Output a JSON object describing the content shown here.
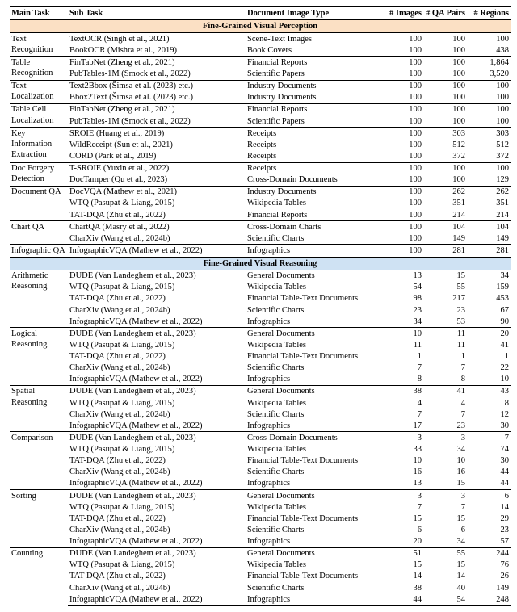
{
  "headers": {
    "main_task": "Main Task",
    "sub_task": "Sub Task",
    "doc_type": "Document Image Type",
    "n_images": "# Images",
    "n_qa": "# QA Pairs",
    "n_regions": "# Regions"
  },
  "sections": [
    {
      "title": "Fine-Grained Visual Perception",
      "class": "section-perception",
      "groups": [
        {
          "main": "Text Recognition",
          "rows": [
            {
              "sub": "TextOCR (Singh et al., 2021)",
              "doc": "Scene-Text Images",
              "i": "100",
              "q": "100",
              "r": "100"
            },
            {
              "sub": "BookOCR (Mishra et al., 2019)",
              "doc": "Book Covers",
              "i": "100",
              "q": "100",
              "r": "438"
            }
          ]
        },
        {
          "main": "Table Recognition",
          "rows": [
            {
              "sub": "FinTabNet (Zheng et al., 2021)",
              "doc": "Financial Reports",
              "i": "100",
              "q": "100",
              "r": "1,864"
            },
            {
              "sub": "PubTables-1M (Smock et al., 2022)",
              "doc": "Scientific Papers",
              "i": "100",
              "q": "100",
              "r": "3,520"
            }
          ]
        },
        {
          "main": "Text Localization",
          "rows": [
            {
              "sub": "Text2Bbox (Šimsa et al. (2023) etc.)",
              "doc": "Industry Documents",
              "i": "100",
              "q": "100",
              "r": "100"
            },
            {
              "sub": "Bbox2Text (Šimsa et al. (2023) etc.)",
              "doc": "Industry Documents",
              "i": "100",
              "q": "100",
              "r": "100"
            }
          ]
        },
        {
          "main": "Table Cell Localization",
          "rows": [
            {
              "sub": "FinTabNet (Zheng et al., 2021)",
              "doc": "Financial Reports",
              "i": "100",
              "q": "100",
              "r": "100"
            },
            {
              "sub": "PubTables-1M (Smock et al., 2022)",
              "doc": "Scientific Papers",
              "i": "100",
              "q": "100",
              "r": "100"
            }
          ]
        },
        {
          "main": "Key Information Extraction",
          "rows": [
            {
              "sub": "SROIE (Huang et al., 2019)",
              "doc": "Receipts",
              "i": "100",
              "q": "303",
              "r": "303"
            },
            {
              "sub": "WildReceipt (Sun et al., 2021)",
              "doc": "Receipts",
              "i": "100",
              "q": "512",
              "r": "512"
            },
            {
              "sub": "CORD (Park et al., 2019)",
              "doc": "Receipts",
              "i": "100",
              "q": "372",
              "r": "372"
            }
          ]
        },
        {
          "main": "Doc Forgery Detection",
          "rows": [
            {
              "sub": "T-SROIE (Yuxin et al., 2022)",
              "doc": "Receipts",
              "i": "100",
              "q": "100",
              "r": "100"
            },
            {
              "sub": "DocTamper (Qu et al., 2023)",
              "doc": "Cross-Domain Documents",
              "i": "100",
              "q": "100",
              "r": "129"
            }
          ]
        },
        {
          "main": "Document QA",
          "rows": [
            {
              "sub": "DocVQA (Mathew et al., 2021)",
              "doc": "Industry Documents",
              "i": "100",
              "q": "262",
              "r": "262"
            },
            {
              "sub": "WTQ (Pasupat & Liang, 2015)",
              "doc": "Wikipedia Tables",
              "i": "100",
              "q": "351",
              "r": "351"
            },
            {
              "sub": "TAT-DQA (Zhu et al., 2022)",
              "doc": "Financial Reports",
              "i": "100",
              "q": "214",
              "r": "214"
            }
          ]
        },
        {
          "main": "Chart QA",
          "rows": [
            {
              "sub": "ChartQA (Masry et al., 2022)",
              "doc": "Cross-Domain Charts",
              "i": "100",
              "q": "104",
              "r": "104"
            },
            {
              "sub": "CharXiv (Wang et al., 2024b)",
              "doc": "Scientific Charts",
              "i": "100",
              "q": "149",
              "r": "149"
            }
          ]
        },
        {
          "main": "Infographic QA",
          "rows": [
            {
              "sub": "InfographicVQA (Mathew et al., 2022)",
              "doc": "Infographics",
              "i": "100",
              "q": "281",
              "r": "281"
            }
          ]
        }
      ]
    },
    {
      "title": "Fine-Grained Visual Reasoning",
      "class": "section-reasoning",
      "groups": [
        {
          "main": "Arithmetic Reasoning",
          "rows": [
            {
              "sub": "DUDE (Van Landeghem et al., 2023)",
              "doc": "General Documents",
              "i": "13",
              "q": "15",
              "r": "34"
            },
            {
              "sub": "WTQ (Pasupat & Liang, 2015)",
              "doc": "Wikipedia Tables",
              "i": "54",
              "q": "55",
              "r": "159"
            },
            {
              "sub": "TAT-DQA (Zhu et al., 2022)",
              "doc": "Financial Table-Text Documents",
              "i": "98",
              "q": "217",
              "r": "453"
            },
            {
              "sub": "CharXiv (Wang et al., 2024b)",
              "doc": "Scientific Charts",
              "i": "23",
              "q": "23",
              "r": "67"
            },
            {
              "sub": "InfographicVQA (Mathew et al., 2022)",
              "doc": "Infographics",
              "i": "34",
              "q": "53",
              "r": "90"
            }
          ]
        },
        {
          "main": "Logical Reasoning",
          "rows": [
            {
              "sub": "DUDE (Van Landeghem et al., 2023)",
              "doc": "General Documents",
              "i": "10",
              "q": "11",
              "r": "20"
            },
            {
              "sub": "WTQ (Pasupat & Liang, 2015)",
              "doc": "Wikipedia Tables",
              "i": "11",
              "q": "11",
              "r": "41"
            },
            {
              "sub": "TAT-DQA (Zhu et al., 2022)",
              "doc": "Financial Table-Text Documents",
              "i": "1",
              "q": "1",
              "r": "1"
            },
            {
              "sub": "CharXiv (Wang et al., 2024b)",
              "doc": "Scientific Charts",
              "i": "7",
              "q": "7",
              "r": "22"
            },
            {
              "sub": "InfographicVQA (Mathew et al., 2022)",
              "doc": "Infographics",
              "i": "8",
              "q": "8",
              "r": "10"
            }
          ]
        },
        {
          "main": "Spatial Reasoning",
          "rows": [
            {
              "sub": "DUDE (Van Landeghem et al., 2023)",
              "doc": "General Documents",
              "i": "38",
              "q": "41",
              "r": "43"
            },
            {
              "sub": "WTQ (Pasupat & Liang, 2015)",
              "doc": "Wikipedia Tables",
              "i": "4",
              "q": "4",
              "r": "8"
            },
            {
              "sub": "CharXiv (Wang et al., 2024b)",
              "doc": "Scientific Charts",
              "i": "7",
              "q": "7",
              "r": "12"
            },
            {
              "sub": "InfographicVQA (Mathew et al., 2022)",
              "doc": "Infographics",
              "i": "17",
              "q": "23",
              "r": "30"
            }
          ]
        },
        {
          "main": "Comparison",
          "rows": [
            {
              "sub": "DUDE (Van Landeghem et al., 2023)",
              "doc": "Cross-Domain Documents",
              "i": "3",
              "q": "3",
              "r": "7"
            },
            {
              "sub": "WTQ (Pasupat & Liang, 2015)",
              "doc": "Wikipedia Tables",
              "i": "33",
              "q": "34",
              "r": "74"
            },
            {
              "sub": "TAT-DQA (Zhu et al., 2022)",
              "doc": "Financial Table-Text Documents",
              "i": "10",
              "q": "10",
              "r": "30"
            },
            {
              "sub": "CharXiv (Wang et al., 2024b)",
              "doc": "Scientific Charts",
              "i": "16",
              "q": "16",
              "r": "44"
            },
            {
              "sub": "InfographicVQA (Mathew et al., 2022)",
              "doc": "Infographics",
              "i": "13",
              "q": "15",
              "r": "44"
            }
          ]
        },
        {
          "main": "Sorting",
          "rows": [
            {
              "sub": "DUDE (Van Landeghem et al., 2023)",
              "doc": "General Documents",
              "i": "3",
              "q": "3",
              "r": "6"
            },
            {
              "sub": "WTQ (Pasupat & Liang, 2015)",
              "doc": "Wikipedia Tables",
              "i": "7",
              "q": "7",
              "r": "14"
            },
            {
              "sub": "TAT-DQA (Zhu et al., 2022)",
              "doc": "Financial Table-Text Documents",
              "i": "15",
              "q": "15",
              "r": "29"
            },
            {
              "sub": "CharXiv (Wang et al., 2024b)",
              "doc": "Scientific Charts",
              "i": "6",
              "q": "6",
              "r": "23"
            },
            {
              "sub": "InfographicVQA (Mathew et al., 2022)",
              "doc": "Infographics",
              "i": "20",
              "q": "34",
              "r": "57"
            }
          ]
        },
        {
          "main": "Counting",
          "rows": [
            {
              "sub": "DUDE (Van Landeghem et al., 2023)",
              "doc": "General Documents",
              "i": "51",
              "q": "55",
              "r": "244"
            },
            {
              "sub": "WTQ (Pasupat & Liang, 2015)",
              "doc": "Wikipedia Tables",
              "i": "15",
              "q": "15",
              "r": "76"
            },
            {
              "sub": "TAT-DQA (Zhu et al., 2022)",
              "doc": "Financial Table-Text Documents",
              "i": "14",
              "q": "14",
              "r": "26"
            },
            {
              "sub": "CharXiv (Wang et al., 2024b)",
              "doc": "Scientific Charts",
              "i": "38",
              "q": "40",
              "r": "149"
            },
            {
              "sub": "InfographicVQA (Mathew et al., 2022)",
              "doc": "Infographics",
              "i": "44",
              "q": "54",
              "r": "248"
            }
          ]
        }
      ]
    }
  ]
}
